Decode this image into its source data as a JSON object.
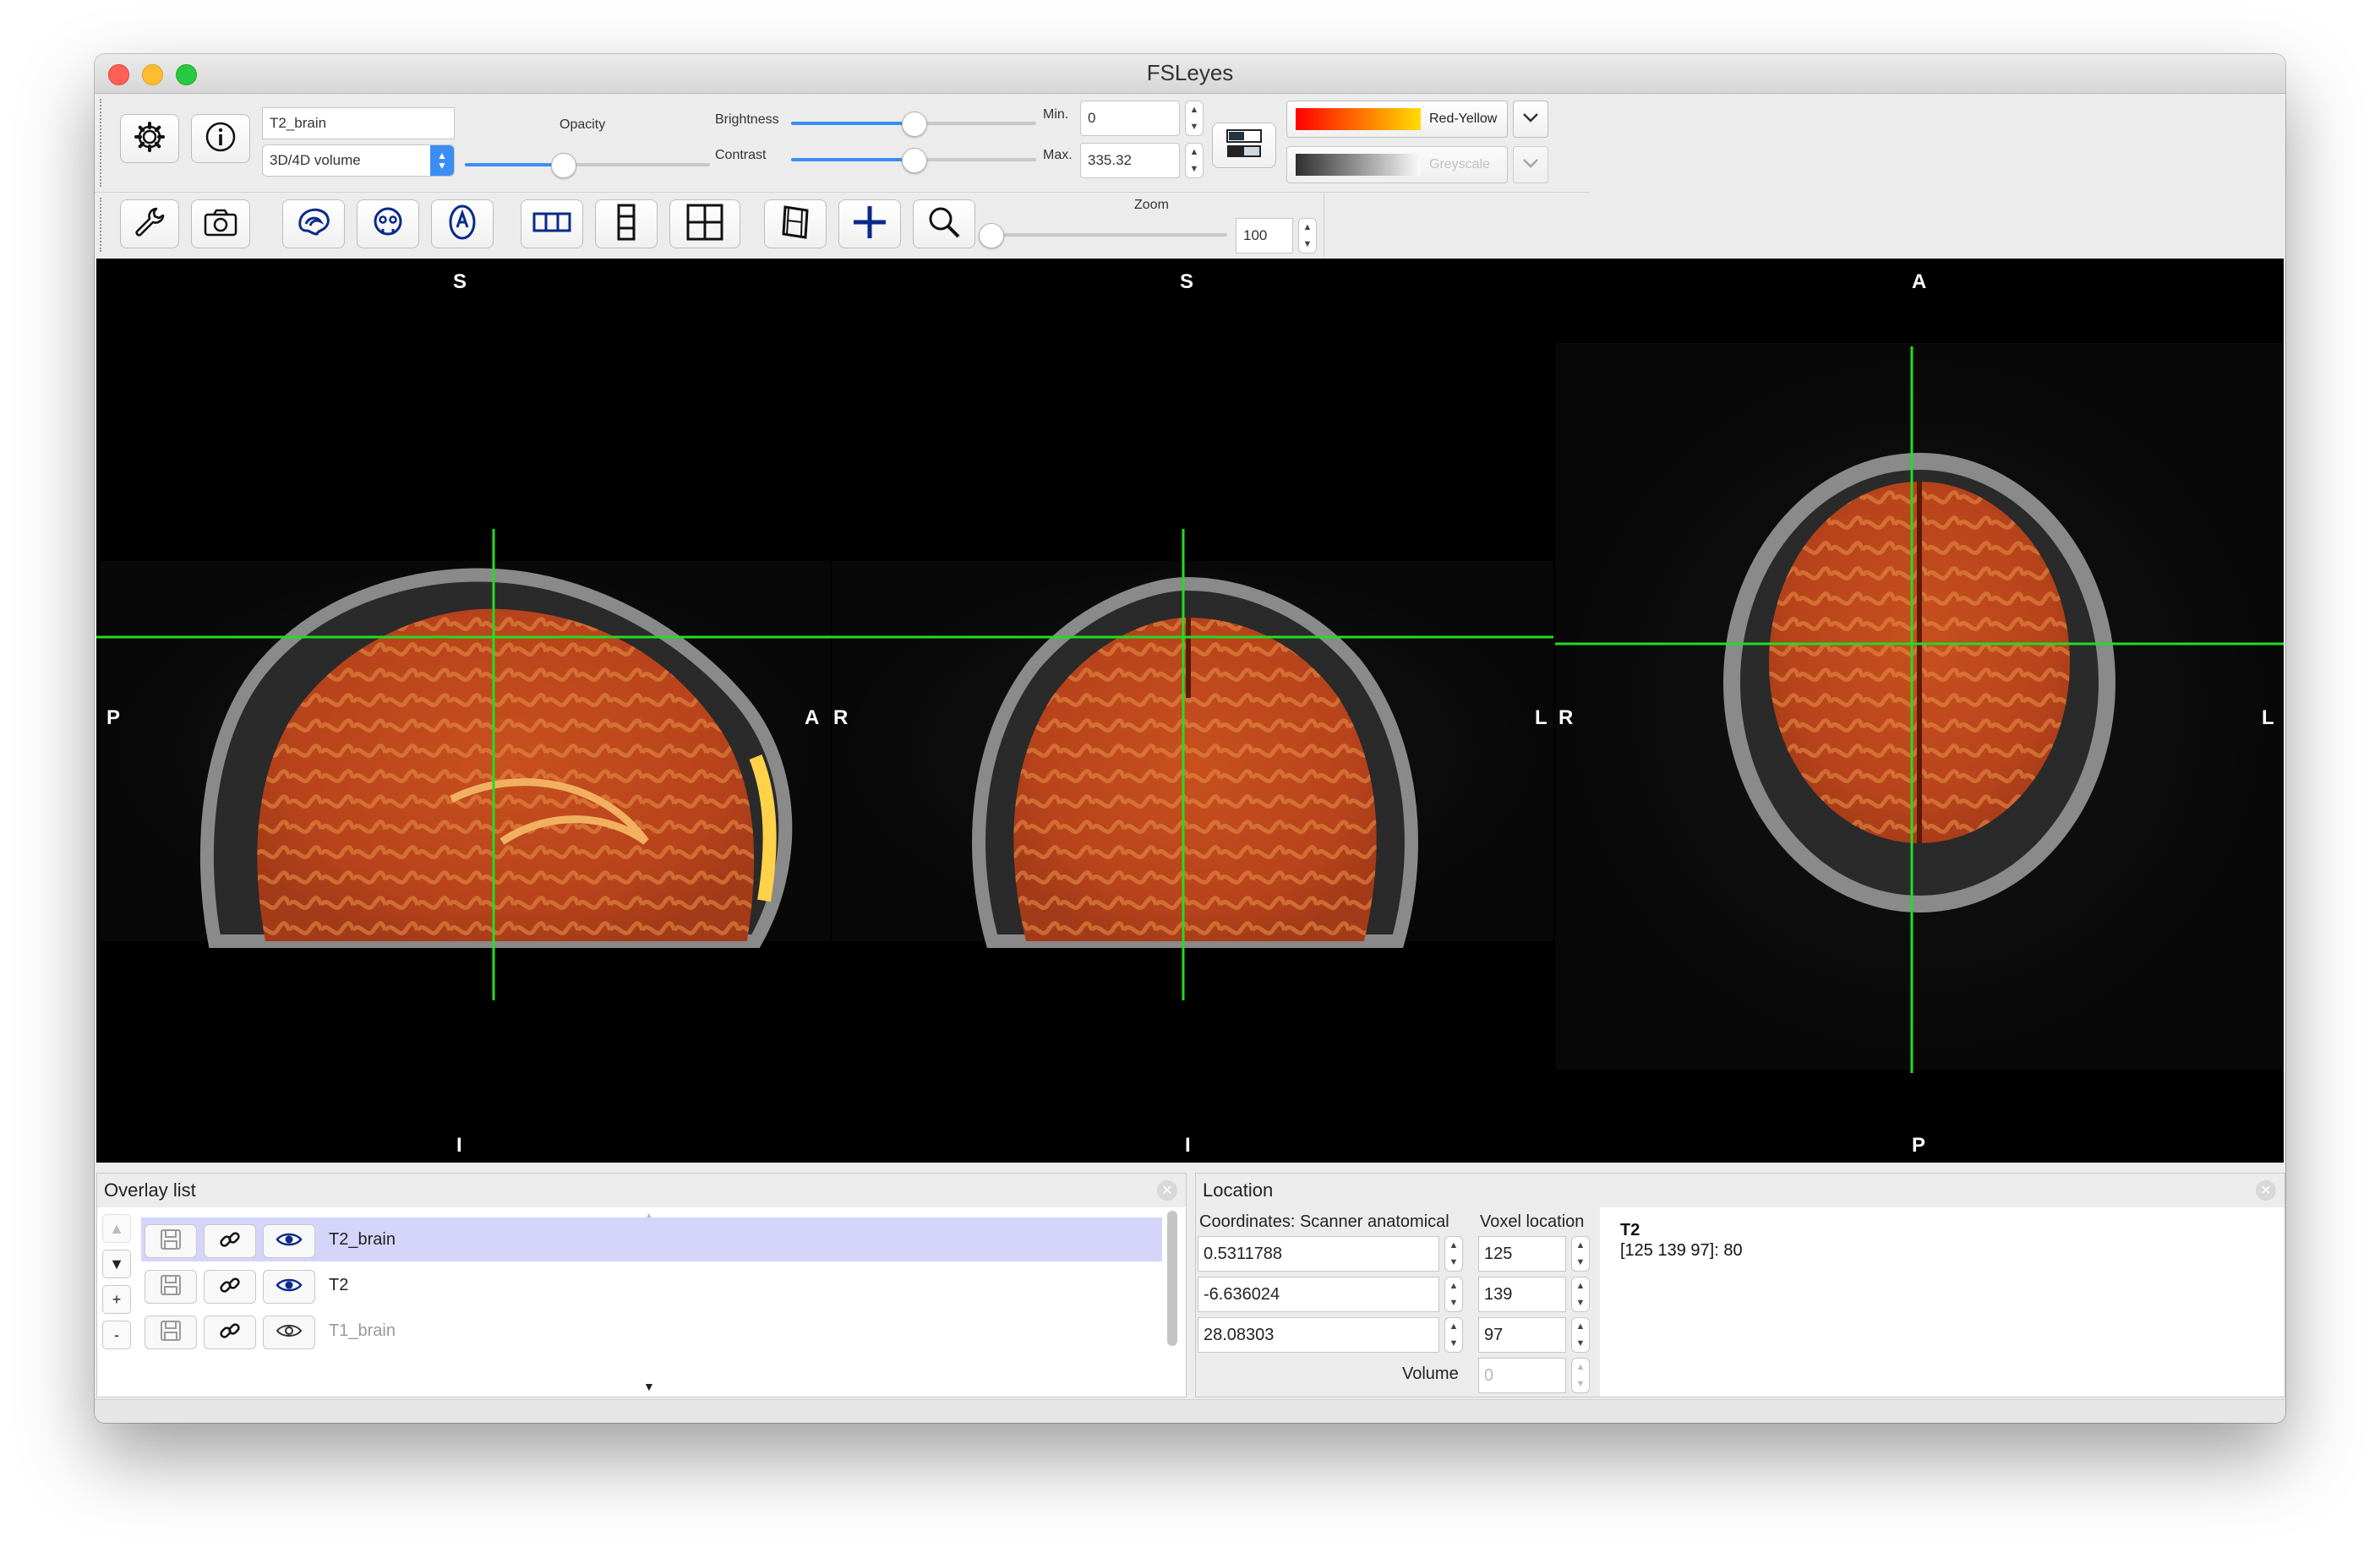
{
  "window": {
    "title": "FSLeyes"
  },
  "overlay_toolbar": {
    "overlay_name": "T2_brain",
    "overlay_type": "3D/4D volume",
    "opacity_label": "Opacity",
    "opacity_value": 0.4,
    "brightness_label": "Brightness",
    "brightness_value": 0.5,
    "contrast_label": "Contrast",
    "contrast_value": 0.5,
    "min_label": "Min.",
    "min_value": "0",
    "max_label": "Max.",
    "max_value": "335.32",
    "cmap_label": "Red-Yellow",
    "neg_cmap_label": "Greyscale"
  },
  "ortho_toolbar": {
    "zoom_label": "Zoom",
    "zoom_value": "100",
    "zoom_fraction": 0.0
  },
  "icons": [
    "gear-icon",
    "info-icon",
    "wrench-icon",
    "camera-icon",
    "sagittal-icon",
    "coronal-icon",
    "axial-icon",
    "layout-horizontal-icon",
    "layout-vertical-icon",
    "layout-grid-icon",
    "movie-icon",
    "crosshair-icon",
    "magnifier-icon",
    "save-icon",
    "link-icon",
    "eye-icon"
  ],
  "colors": {
    "crosshair": "#22dd22",
    "overlay": "#c0441a",
    "selected_row": "#d5d5fb"
  },
  "orientation": {
    "sagittal": {
      "top": "S",
      "bottom": "I",
      "left": "P",
      "right": "A"
    },
    "coronal": {
      "top": "S",
      "bottom": "I",
      "left": "R",
      "right": "L"
    },
    "axial": {
      "top": "A",
      "bottom": "P",
      "left": "R",
      "right": "L"
    }
  },
  "overlay_list": {
    "title": "Overlay list",
    "items": [
      {
        "name": "T2_brain",
        "selected": true,
        "visible": true
      },
      {
        "name": "T2",
        "selected": false,
        "visible": true
      },
      {
        "name": "T1_brain",
        "selected": false,
        "visible": false
      }
    ],
    "up_label": "▲",
    "down_label": "▼",
    "add_label": "+",
    "remove_label": "-"
  },
  "location": {
    "title": "Location",
    "coords_header": "Coordinates: Scanner anatomical",
    "voxel_header": "Voxel location",
    "coords": [
      "0.5311788",
      "-6.636024",
      "28.08303"
    ],
    "voxels": [
      "125",
      "139",
      "97"
    ],
    "volume_label": "Volume",
    "volume_value": "0",
    "info_name": "T2",
    "info_value": "[125 139 97]: 80"
  }
}
